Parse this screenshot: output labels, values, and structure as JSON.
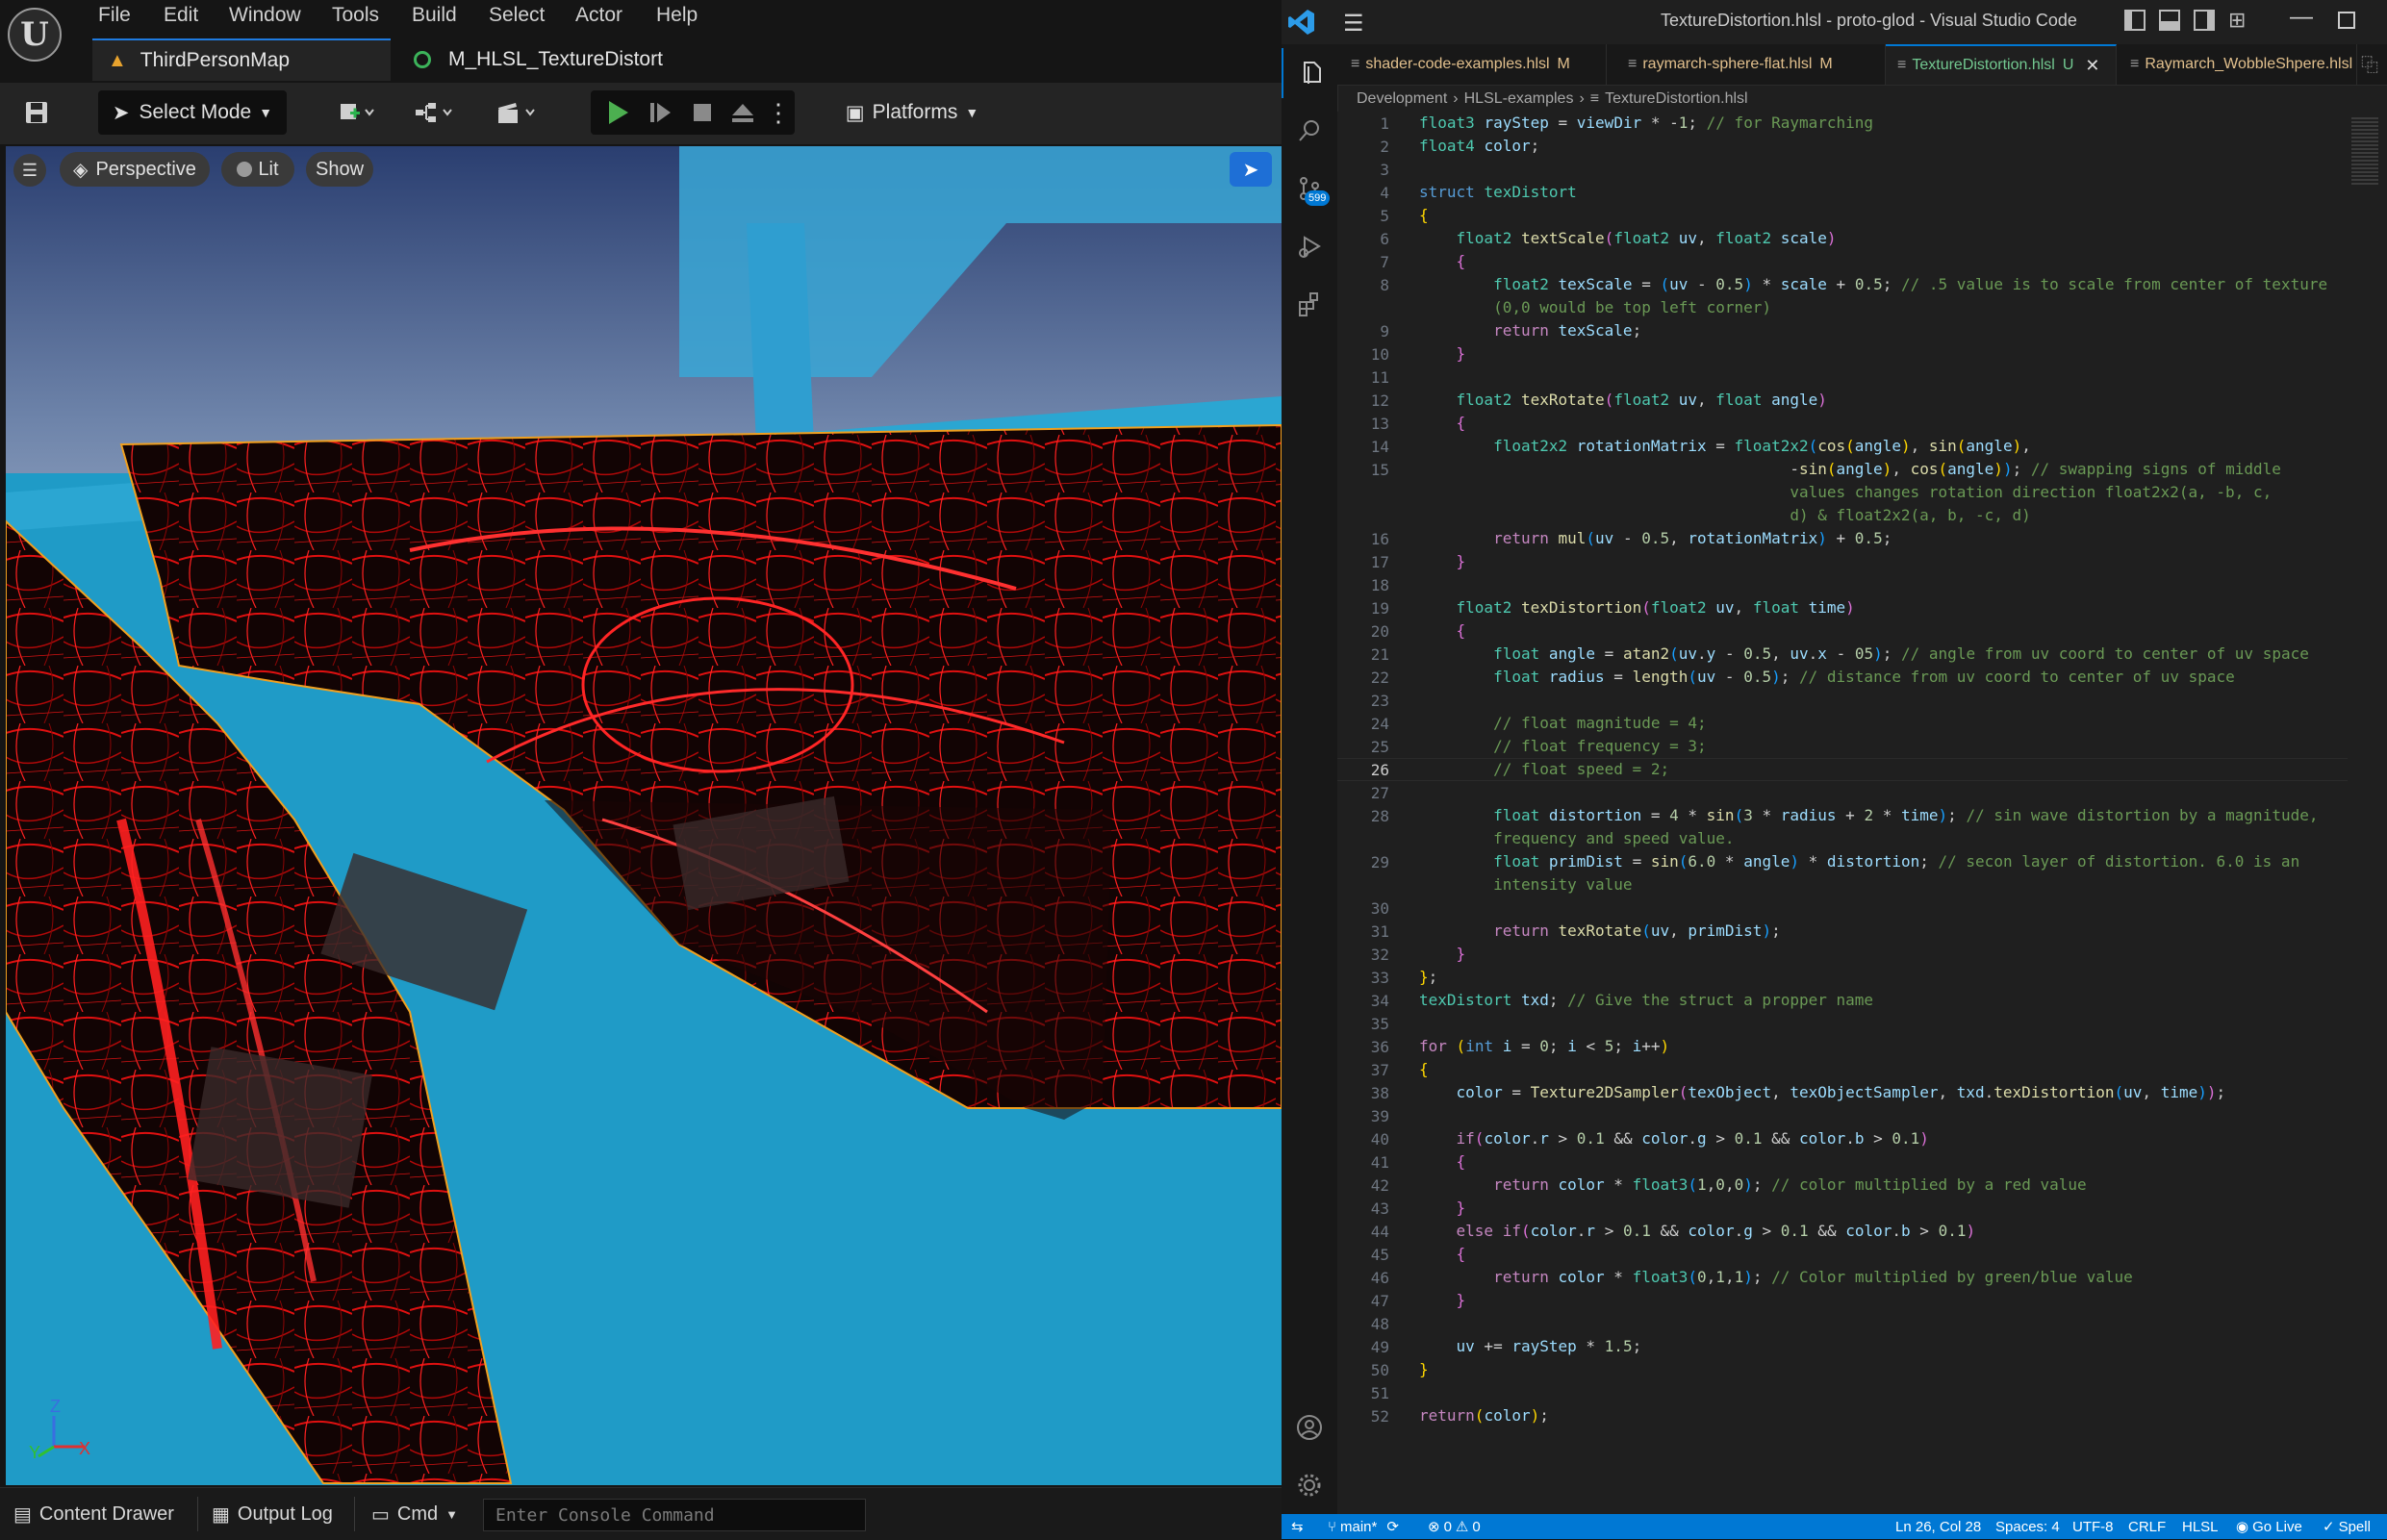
{
  "unreal": {
    "menu": [
      "File",
      "Edit",
      "Window",
      "Tools",
      "Build",
      "Select",
      "Actor",
      "Help"
    ],
    "tabs": [
      {
        "label": "ThirdPersonMap",
        "icon": "warning-icon"
      },
      {
        "label": "M_HLSL_TextureDistort",
        "icon": "material-icon"
      }
    ],
    "toolbar": {
      "select_mode": "Select Mode",
      "platforms": "Platforms"
    },
    "viewport": {
      "perspective": "Perspective",
      "lit": "Lit",
      "show": "Show",
      "axis_z": "Z",
      "axis_y": "Y",
      "axis_x": "X"
    },
    "bottom": {
      "content_drawer": "Content Drawer",
      "output_log": "Output Log",
      "cmd": "Cmd",
      "console_placeholder": "Enter Console Command"
    }
  },
  "vscode": {
    "title": "TextureDistortion.hlsl - proto-glod - Visual Studio Code",
    "scm_badge": "599",
    "tabs": [
      {
        "label": "shader-code-examples.hlsl",
        "status": "M",
        "active": false
      },
      {
        "label": "raymarch-sphere-flat.hlsl",
        "status": "M",
        "active": false
      },
      {
        "label": "TextureDistortion.hlsl",
        "status": "U",
        "active": true
      },
      {
        "label": "Raymarch_WobbleShpere.hlsl",
        "status": "",
        "active": false
      }
    ],
    "breadcrumb": [
      "Development",
      "HLSL-examples",
      "TextureDistortion.hlsl"
    ],
    "current_line": 26,
    "lines": [
      {
        "n": "1",
        "html": "<span class='t'>float3</span> <span class='v'>rayStep</span> = <span class='v'>viewDir</span> * -<span class='n'>1</span>; <span class='c'>// for Raymarching</span>"
      },
      {
        "n": "2",
        "html": "<span class='t'>float4</span> <span class='v'>color</span>;"
      },
      {
        "n": "3",
        "html": ""
      },
      {
        "n": "4",
        "html": "<span class='k'>struct</span> <span class='t'>texDistort</span>"
      },
      {
        "n": "5",
        "html": "<span class='b1'>{</span>"
      },
      {
        "n": "6",
        "html": "    <span class='t'>float2</span> <span class='f'>textScale</span><span class='b2'>(</span><span class='t'>float2</span> <span class='v'>uv</span>, <span class='t'>float2</span> <span class='v'>scale</span><span class='b2'>)</span>"
      },
      {
        "n": "7",
        "html": "    <span class='b2'>{</span>"
      },
      {
        "n": "8",
        "html": "        <span class='t'>float2</span> <span class='v'>texScale</span> = <span class='b3'>(</span><span class='v'>uv</span> - <span class='n'>0.5</span><span class='b3'>)</span> * <span class='v'>scale</span> + <span class='n'>0.5</span>; <span class='c'>// .5 value is to scale from center of texture</span>"
      },
      {
        "n": "",
        "html": "        <span class='c'>(0,0 would be top left corner)</span>"
      },
      {
        "n": "9",
        "html": "        <span class='p'>return</span> <span class='v'>texScale</span>;"
      },
      {
        "n": "10",
        "html": "    <span class='b2'>}</span>"
      },
      {
        "n": "11",
        "html": ""
      },
      {
        "n": "12",
        "html": "    <span class='t'>float2</span> <span class='f'>texRotate</span><span class='b2'>(</span><span class='t'>float2</span> <span class='v'>uv</span>, <span class='t'>float</span> <span class='v'>angle</span><span class='b2'>)</span>"
      },
      {
        "n": "13",
        "html": "    <span class='b2'>{</span>"
      },
      {
        "n": "14",
        "html": "        <span class='t'>float2x2</span> <span class='v'>rotationMatrix</span> = <span class='t'>float2x2</span><span class='b3'>(</span><span class='f'>cos</span><span class='b1'>(</span><span class='v'>angle</span><span class='b1'>)</span>, <span class='f'>sin</span><span class='b1'>(</span><span class='v'>angle</span><span class='b1'>)</span>,"
      },
      {
        "n": "15",
        "html": "                                        -<span class='f'>sin</span><span class='b1'>(</span><span class='v'>angle</span><span class='b1'>)</span>, <span class='f'>cos</span><span class='b1'>(</span><span class='v'>angle</span><span class='b1'>)</span><span class='b3'>)</span>; <span class='c'>// swapping signs of middle</span>"
      },
      {
        "n": "",
        "html": "                                        <span class='c'>values changes rotation direction float2x2(a, -b, c,</span>"
      },
      {
        "n": "",
        "html": "                                        <span class='c'>d) &amp; float2x2(a, b, -c, d)</span>"
      },
      {
        "n": "16",
        "html": "        <span class='p'>return</span> <span class='f'>mul</span><span class='b3'>(</span><span class='v'>uv</span> - <span class='n'>0.5</span>, <span class='v'>rotationMatrix</span><span class='b3'>)</span> + <span class='n'>0.5</span>;"
      },
      {
        "n": "17",
        "html": "    <span class='b2'>}</span>"
      },
      {
        "n": "18",
        "html": ""
      },
      {
        "n": "19",
        "html": "    <span class='t'>float2</span> <span class='f'>texDistortion</span><span class='b2'>(</span><span class='t'>float2</span> <span class='v'>uv</span>, <span class='t'>float</span> <span class='v'>time</span><span class='b2'>)</span>"
      },
      {
        "n": "20",
        "html": "    <span class='b2'>{</span>"
      },
      {
        "n": "21",
        "html": "        <span class='t'>float</span> <span class='v'>angle</span> = <span class='f'>atan2</span><span class='b3'>(</span><span class='v'>uv</span>.<span class='v'>y</span> - <span class='n'>0.5</span>, <span class='v'>uv</span>.<span class='v'>x</span> - <span class='n'>05</span><span class='b3'>)</span>; <span class='c'>// angle from uv coord to center of uv space</span>"
      },
      {
        "n": "22",
        "html": "        <span class='t'>float</span> <span class='v'>radius</span> = <span class='f'>length</span><span class='b3'>(</span><span class='v'>uv</span> - <span class='n'>0.5</span><span class='b3'>)</span>; <span class='c'>// distance from uv coord to center of uv space</span>"
      },
      {
        "n": "23",
        "html": ""
      },
      {
        "n": "24",
        "html": "        <span class='c'>// float magnitude = 4;</span>"
      },
      {
        "n": "25",
        "html": "        <span class='c'>// float frequency = 3;</span>"
      },
      {
        "n": "26",
        "html": "        <span class='c'>// float speed = 2;</span>"
      },
      {
        "n": "27",
        "html": ""
      },
      {
        "n": "28",
        "html": "        <span class='t'>float</span> <span class='v'>distortion</span> = <span class='n'>4</span> * <span class='f'>sin</span><span class='b3'>(</span><span class='n'>3</span> * <span class='v'>radius</span> + <span class='n'>2</span> * <span class='v'>time</span><span class='b3'>)</span>; <span class='c'>// sin wave distortion by a magnitude,</span>"
      },
      {
        "n": "",
        "html": "        <span class='c'>frequency and speed value.</span>"
      },
      {
        "n": "29",
        "html": "        <span class='t'>float</span> <span class='v'>primDist</span> = <span class='f'>sin</span><span class='b3'>(</span><span class='n'>6.0</span> * <span class='v'>angle</span><span class='b3'>)</span> * <span class='v'>distortion</span>; <span class='c'>// secon layer of distortion. 6.0 is an</span>"
      },
      {
        "n": "",
        "html": "        <span class='c'>intensity value</span>"
      },
      {
        "n": "30",
        "html": ""
      },
      {
        "n": "31",
        "html": "        <span class='p'>return</span> <span class='f'>texRotate</span><span class='b3'>(</span><span class='v'>uv</span>, <span class='v'>primDist</span><span class='b3'>)</span>;"
      },
      {
        "n": "32",
        "html": "    <span class='b2'>}</span>"
      },
      {
        "n": "33",
        "html": "<span class='b1'>}</span>;"
      },
      {
        "n": "34",
        "html": "<span class='t'>texDistort</span> <span class='v'>txd</span>; <span class='c'>// Give the struct a propper name</span>"
      },
      {
        "n": "35",
        "html": ""
      },
      {
        "n": "36",
        "html": "<span class='p'>for</span> <span class='b1'>(</span><span class='k'>int</span> <span class='v'>i</span> = <span class='n'>0</span>; <span class='v'>i</span> &lt; <span class='n'>5</span>; <span class='v'>i</span>++<span class='b1'>)</span>"
      },
      {
        "n": "37",
        "html": "<span class='b1'>{</span>"
      },
      {
        "n": "38",
        "html": "    <span class='v'>color</span> = <span class='f'>Texture2DSampler</span><span class='b2'>(</span><span class='v'>texObject</span>, <span class='v'>texObjectSampler</span>, <span class='v'>txd</span>.<span class='f'>texDistortion</span><span class='b3'>(</span><span class='v'>uv</span>, <span class='v'>time</span><span class='b3'>)</span><span class='b2'>)</span>;"
      },
      {
        "n": "39",
        "html": ""
      },
      {
        "n": "40",
        "html": "    <span class='p'>if</span><span class='b2'>(</span><span class='v'>color</span>.<span class='v'>r</span> &gt; <span class='n'>0.1</span> &amp;&amp; <span class='v'>color</span>.<span class='v'>g</span> &gt; <span class='n'>0.1</span> &amp;&amp; <span class='v'>color</span>.<span class='v'>b</span> &gt; <span class='n'>0.1</span><span class='b2'>)</span>"
      },
      {
        "n": "41",
        "html": "    <span class='b2'>{</span>"
      },
      {
        "n": "42",
        "html": "        <span class='p'>return</span> <span class='v'>color</span> * <span class='t'>float3</span><span class='b3'>(</span><span class='n'>1</span>,<span class='n'>0</span>,<span class='n'>0</span><span class='b3'>)</span>; <span class='c'>// color multiplied by a red value</span>"
      },
      {
        "n": "43",
        "html": "    <span class='b2'>}</span>"
      },
      {
        "n": "44",
        "html": "    <span class='p'>else</span> <span class='p'>if</span><span class='b2'>(</span><span class='v'>color</span>.<span class='v'>r</span> &gt; <span class='n'>0.1</span> &amp;&amp; <span class='v'>color</span>.<span class='v'>g</span> &gt; <span class='n'>0.1</span> &amp;&amp; <span class='v'>color</span>.<span class='v'>b</span> &gt; <span class='n'>0.1</span><span class='b2'>)</span>"
      },
      {
        "n": "45",
        "html": "    <span class='b2'>{</span>"
      },
      {
        "n": "46",
        "html": "        <span class='p'>return</span> <span class='v'>color</span> * <span class='t'>float3</span><span class='b3'>(</span><span class='n'>0</span>,<span class='n'>1</span>,<span class='n'>1</span><span class='b3'>)</span>; <span class='c'>// Color multiplied by green/blue value</span>"
      },
      {
        "n": "47",
        "html": "    <span class='b2'>}</span>"
      },
      {
        "n": "48",
        "html": ""
      },
      {
        "n": "49",
        "html": "    <span class='v'>uv</span> += <span class='v'>rayStep</span> * <span class='n'>1.5</span>;"
      },
      {
        "n": "50",
        "html": "<span class='b1'>}</span>"
      },
      {
        "n": "51",
        "html": ""
      },
      {
        "n": "52",
        "html": "<span class='p'>return</span><span class='b1'>(</span><span class='v'>color</span><span class='b1'>)</span>;"
      }
    ],
    "status": {
      "branch": "main*",
      "errors": "0",
      "warnings": "0",
      "position": "Ln 26, Col 28",
      "spaces": "Spaces: 4",
      "encoding": "UTF-8",
      "eol": "CRLF",
      "language": "HLSL",
      "golive": "Go Live",
      "spell": "Spell"
    }
  }
}
